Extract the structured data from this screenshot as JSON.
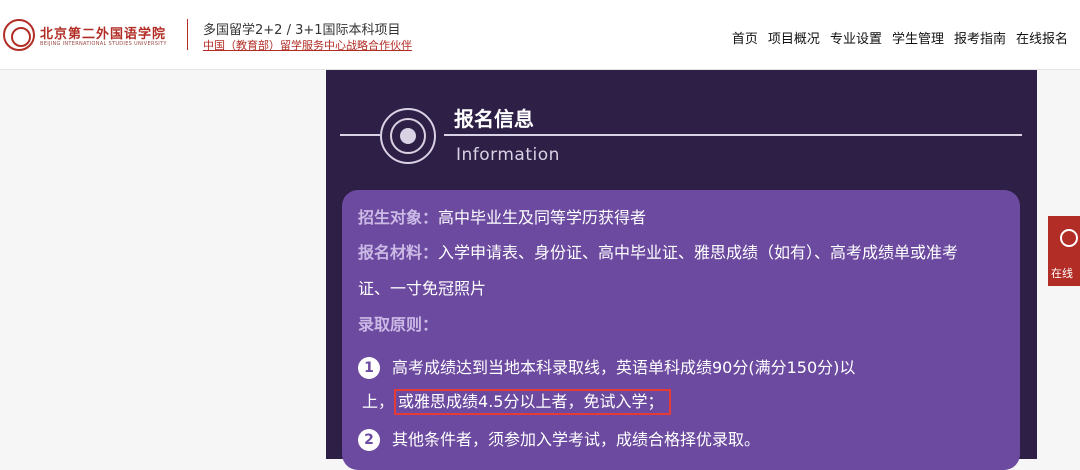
{
  "header": {
    "logo_cn": "北京第二外国语学院",
    "logo_en": "BEIJING INTERNATIONAL STUDIES UNIVERSITY",
    "program_title": "多国留学2+2 / 3+1国际本科项目",
    "program_sub": "中国（教育部）留学服务中心战略合作伙伴",
    "brand_color": "#b22d25"
  },
  "nav": [
    "首页",
    "项目概况",
    "专业设置",
    "学生管理",
    "报考指南",
    "在线报名"
  ],
  "section": {
    "title": "报名信息",
    "subtitle": "Information",
    "panel_color": "#2e1f47",
    "card_color": "#6c4aa0"
  },
  "info": {
    "target_label": "招生对象：",
    "target_value": "高中毕业生及同等学历获得者",
    "materials_label": "报名材料：",
    "materials_value_1": "入学申请表、身份证、高中毕业证、雅思成绩（如有）、高考成绩单或准考",
    "materials_value_2": "证、一寸免冠照片",
    "principles_label": "录取原则：",
    "item1_num": "1",
    "item1_line1": "高考成绩达到当地本科录取线，英语单科成绩90分(满分150分)以",
    "item1_line2_prefix": "上，",
    "item1_highlight": "或雅思成绩4.5分以上者，免试入学；",
    "item2_num": "2",
    "item2_text": "其他条件者，须参加入学考试，成绩合格择优录取。"
  },
  "float_widget": {
    "label": "在线",
    "icon": "headset-icon"
  }
}
